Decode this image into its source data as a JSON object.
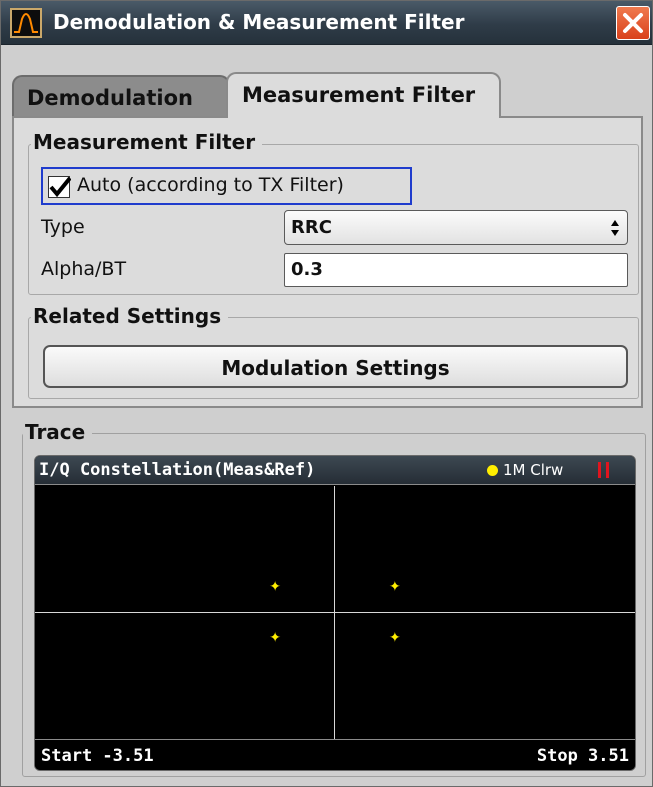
{
  "window": {
    "title": "Demodulation & Measurement Filter",
    "close_icon": "close-icon"
  },
  "tabs": [
    {
      "label": "Demodulation",
      "active": false
    },
    {
      "label": "Measurement Filter",
      "active": true
    }
  ],
  "measurement_filter": {
    "group_title": "Measurement Filter",
    "auto_checkbox": {
      "label": "Auto (according to TX Filter)",
      "checked": true
    },
    "type": {
      "label": "Type",
      "value": "RRC"
    },
    "alpha_bt": {
      "label": "Alpha/BT",
      "value": "0.3"
    }
  },
  "related_settings": {
    "group_title": "Related Settings",
    "button_label": "Modulation Settings"
  },
  "trace": {
    "group_title": "Trace",
    "plot": {
      "title": "I/Q Constellation(Meas&Ref)",
      "legend": "1M Clrw",
      "legend_color": "#ffee00",
      "start_label": "Start -3.51",
      "stop_label": "Stop 3.51"
    }
  },
  "chart_data": {
    "type": "scatter",
    "title": "I/Q Constellation(Meas&Ref)",
    "x_range": [
      -3.51,
      3.51
    ],
    "y_range": [
      -3.51,
      3.51
    ],
    "grid": true,
    "series": [
      {
        "name": "1M Clrw",
        "color": "#ffee00",
        "points": [
          {
            "x": -0.7,
            "y": 0.7
          },
          {
            "x": 0.7,
            "y": 0.7
          },
          {
            "x": -0.7,
            "y": -0.7
          },
          {
            "x": 0.7,
            "y": -0.7
          }
        ]
      }
    ]
  }
}
